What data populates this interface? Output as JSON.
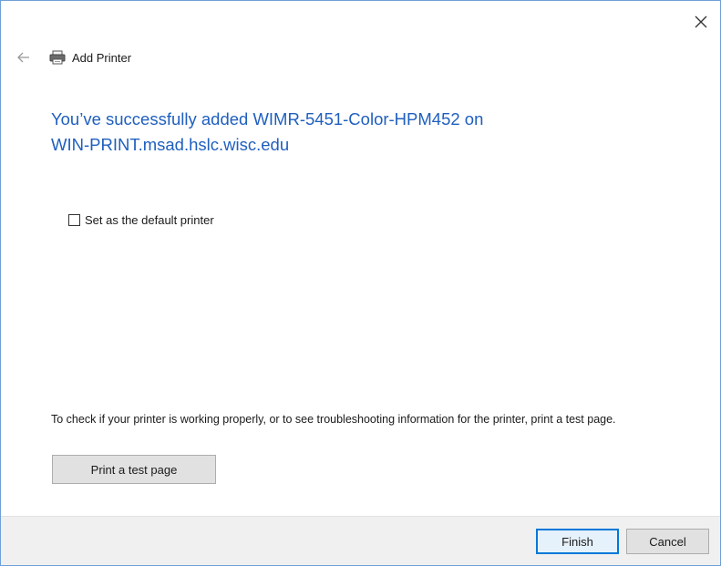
{
  "window": {
    "title": "Add Printer",
    "close_icon": "close-icon",
    "back_icon": "back-arrow-icon",
    "printer_icon": "printer-icon"
  },
  "main": {
    "heading_line1": "You’ve successfully added WIMR-5451-Color-HPM452 on",
    "heading_line2": "WIN-PRINT.msad.hslc.wisc.edu",
    "default_checkbox": {
      "label": "Set as the default printer",
      "checked": false
    },
    "info_text": "To check if your printer is working properly, or to see troubleshooting information for the printer, print a test page.",
    "test_page_button": "Print a test page"
  },
  "footer": {
    "finish_label": "Finish",
    "cancel_label": "Cancel"
  },
  "colors": {
    "heading": "#1f5fbf",
    "window_border": "#6f9fd8",
    "focus_border": "#0078d7",
    "footer_bg": "#f0f0f0"
  }
}
